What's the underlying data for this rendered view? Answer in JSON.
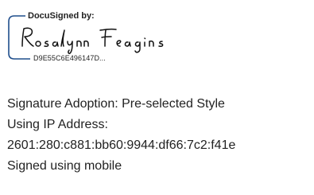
{
  "signature_block": {
    "header": "DocuSigned by:",
    "signer_name_signature": "Rosalynn Feagins",
    "envelope_id": "D9E55C6E496147D...",
    "bracket_color": "#1f4e8c"
  },
  "details": {
    "adoption": "Signature Adoption: Pre-selected Style",
    "ip_label": "Using IP Address:",
    "ip_address": "2601:280:c881:bb60:9944:df66:7c2:f41e",
    "device": "Signed using mobile"
  }
}
